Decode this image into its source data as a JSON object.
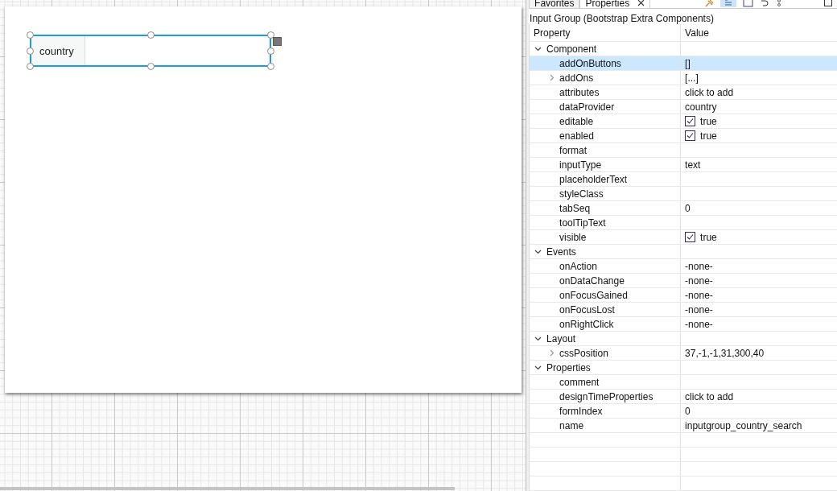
{
  "tabs": [
    {
      "label": "Favorites",
      "selected": false
    },
    {
      "label": "Properties",
      "selected": true
    }
  ],
  "selection_title": "Input Group (Bootstrap Extra Components)",
  "columns": [
    "Property",
    "Value"
  ],
  "design": {
    "addon_label": "country"
  },
  "groups": [
    {
      "label": "Component",
      "expanded": true,
      "children": [
        {
          "name": "addOnButtons",
          "value": "[]",
          "kind": "text",
          "selected": true
        },
        {
          "name": "addOns",
          "value": "[...]",
          "kind": "text",
          "selected": false,
          "expanded": false
        },
        {
          "name": "attributes",
          "value": "click to add",
          "kind": "text",
          "selected": false
        },
        {
          "name": "dataProvider",
          "value": "country",
          "kind": "text",
          "selected": false
        },
        {
          "name": "editable",
          "value": "true",
          "kind": "checkbox",
          "checked": true,
          "selected": false
        },
        {
          "name": "enabled",
          "value": "true",
          "kind": "checkbox",
          "checked": true,
          "selected": false
        },
        {
          "name": "format",
          "kind": "text",
          "selected": false
        },
        {
          "name": "inputType",
          "value": "text",
          "kind": "text",
          "selected": false
        },
        {
          "name": "placeholderText",
          "kind": "text",
          "selected": false
        },
        {
          "name": "styleClass",
          "kind": "text",
          "selected": false
        },
        {
          "name": "tabSeq",
          "value": "0",
          "kind": "text",
          "selected": false
        },
        {
          "name": "toolTipText",
          "kind": "text",
          "selected": false
        },
        {
          "name": "visible",
          "value": "true",
          "kind": "checkbox",
          "checked": true,
          "selected": false
        }
      ]
    },
    {
      "label": "Events",
      "expanded": true,
      "children": [
        {
          "name": "onAction",
          "value": "-none-",
          "kind": "text",
          "selected": false
        },
        {
          "name": "onDataChange",
          "value": "-none-",
          "kind": "text",
          "selected": false
        },
        {
          "name": "onFocusGained",
          "value": "-none-",
          "kind": "text",
          "selected": false
        },
        {
          "name": "onFocusLost",
          "value": "-none-",
          "kind": "text",
          "selected": false
        },
        {
          "name": "onRightClick",
          "value": "-none-",
          "kind": "text",
          "selected": false
        }
      ]
    },
    {
      "label": "Layout",
      "expanded": true,
      "children": [
        {
          "name": "cssPosition",
          "value": "37,-1,-1,31,300,40",
          "kind": "text",
          "selected": false,
          "expanded": false
        }
      ]
    },
    {
      "label": "Properties",
      "expanded": true,
      "children": [
        {
          "name": "comment",
          "kind": "text",
          "selected": false
        },
        {
          "name": "designTimeProperties",
          "value": "click to add",
          "kind": "text",
          "selected": false
        },
        {
          "name": "formIndex",
          "value": "0",
          "kind": "text",
          "selected": false
        },
        {
          "name": "name",
          "value": "inputgroup_country_search",
          "kind": "text",
          "selected": false
        }
      ]
    }
  ]
}
